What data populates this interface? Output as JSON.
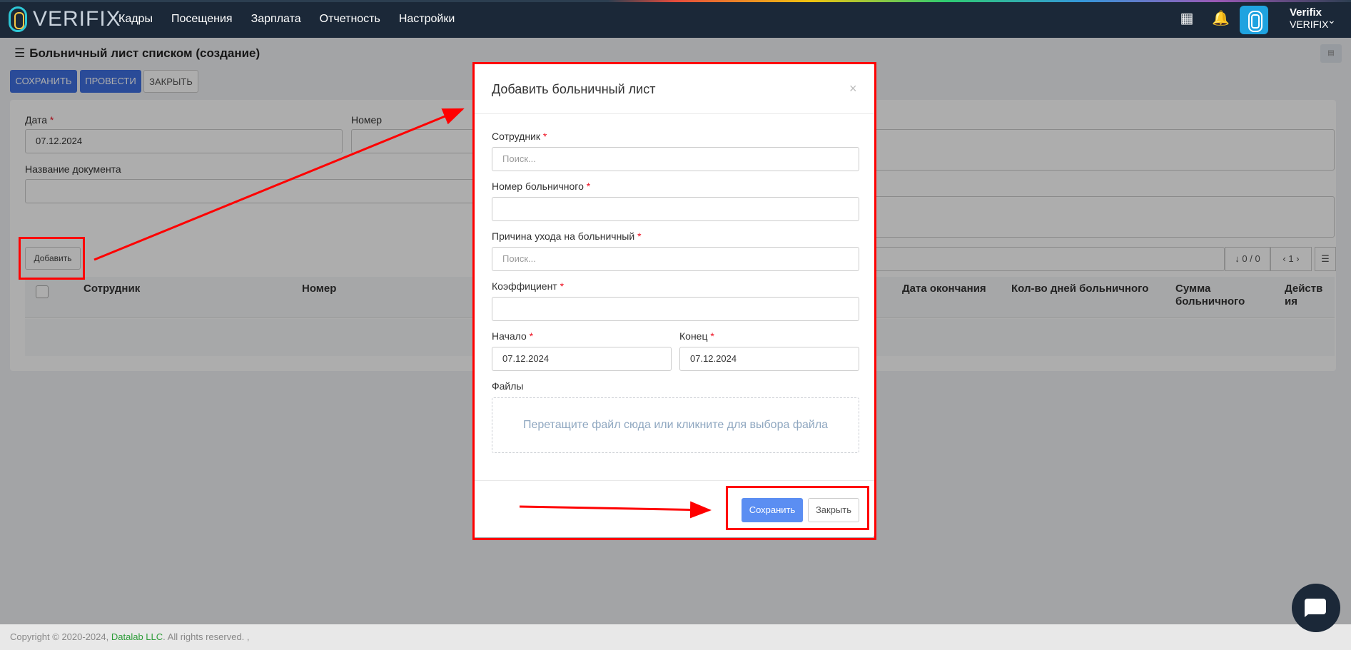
{
  "app": {
    "logo_text": "VERIFIX",
    "nav": [
      "Кадры",
      "Посещения",
      "Зарплата",
      "Отчетность",
      "Настройки"
    ],
    "user": {
      "name": "Verifix",
      "company": "VERIFIX"
    }
  },
  "page": {
    "title": "Больничный лист списком (создание)",
    "buttons": {
      "save": "СОХРАНИТЬ",
      "post": "ПРОВЕСТИ",
      "close": "ЗАКРЫТЬ"
    },
    "fields": {
      "date_label": "Дата",
      "date_value": "07.12.2024",
      "number_label": "Номер",
      "doc_name_label": "Название документа"
    },
    "add_button": "Добавить",
    "grid": {
      "counter": "0 / 0",
      "page": "1",
      "columns": [
        "Сотрудник",
        "Номер",
        "Дата окончания",
        "Кол-во дней больничного",
        "Сумма больничного",
        "Действия"
      ]
    }
  },
  "modal": {
    "title": "Добавить больничный лист",
    "employee_label": "Сотрудник",
    "employee_placeholder": "Поиск...",
    "sick_number_label": "Номер больничного",
    "reason_label": "Причина ухода на больничный",
    "reason_placeholder": "Поиск...",
    "coef_label": "Коэффициент",
    "start_label": "Начало",
    "start_value": "07.12.2024",
    "end_label": "Конец",
    "end_value": "07.12.2024",
    "files_label": "Файлы",
    "dropzone_text": "Перетащите файл сюда или кликните для выбора файла",
    "save": "Сохранить",
    "close": "Закрыть"
  },
  "footer": {
    "prefix": "Copyright © 2020-2024,",
    "company": "Datalab LLC",
    "suffix": ". All rights reserved. ,"
  },
  "colors": {
    "highlight": "#ff0000",
    "nav_bg": "#1b2838",
    "primary": "#3f6fe0"
  }
}
